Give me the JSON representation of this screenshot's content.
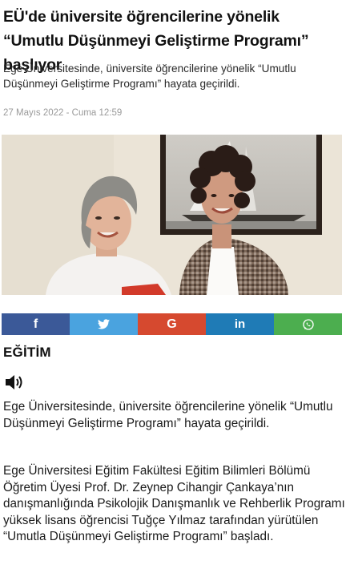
{
  "article": {
    "headline": "EÜ'de üniversite öğrencilerine yönelik “Umutlu Düşünmeyi Geliştirme Programı” başlıyor",
    "summary": "Ege Üniversitesinde, üniversite öğrencilerine yönelik “Umutlu Düşünmeyi Geliştirme Programı” hayata geçirildi.",
    "date": "27 Mayıs 2022 - Cuma 12:59",
    "category": "EĞİTİM",
    "lead": "Ege Üniversitesinde, üniversite öğrencilerine yönelik “Umutlu Düşünmeyi Geliştirme Programı” hayata geçirildi.",
    "body": "Ege Üniversitesi Eğitim Fakültesi Eğitim Bilimleri Bölümü Öğretim Üyesi Prof. Dr. Zeynep Cihangir Çankaya’nın danışmanlığında Psikolojik Danışmanlık ve Rehberlik Programı yüksek lisans öğrencisi Tuğçe Yılmaz tarafından yürütülen “Umutla Düşünmeyi Geliştirme Programı” başladı."
  },
  "share": {
    "buttons": [
      {
        "name": "facebook",
        "icon": "facebook-icon",
        "color": "#3b5998",
        "glyph": "f"
      },
      {
        "name": "twitter",
        "icon": "twitter-icon",
        "color": "#4aa3df",
        "glyph": ""
      },
      {
        "name": "google",
        "icon": "google-icon",
        "color": "#d6492f",
        "glyph": "G"
      },
      {
        "name": "linkedin",
        "icon": "linkedin-icon",
        "color": "#1f7bb6",
        "glyph": "in"
      },
      {
        "name": "whatsapp",
        "icon": "whatsapp-icon",
        "color": "#4cae4f",
        "glyph": ""
      }
    ]
  }
}
